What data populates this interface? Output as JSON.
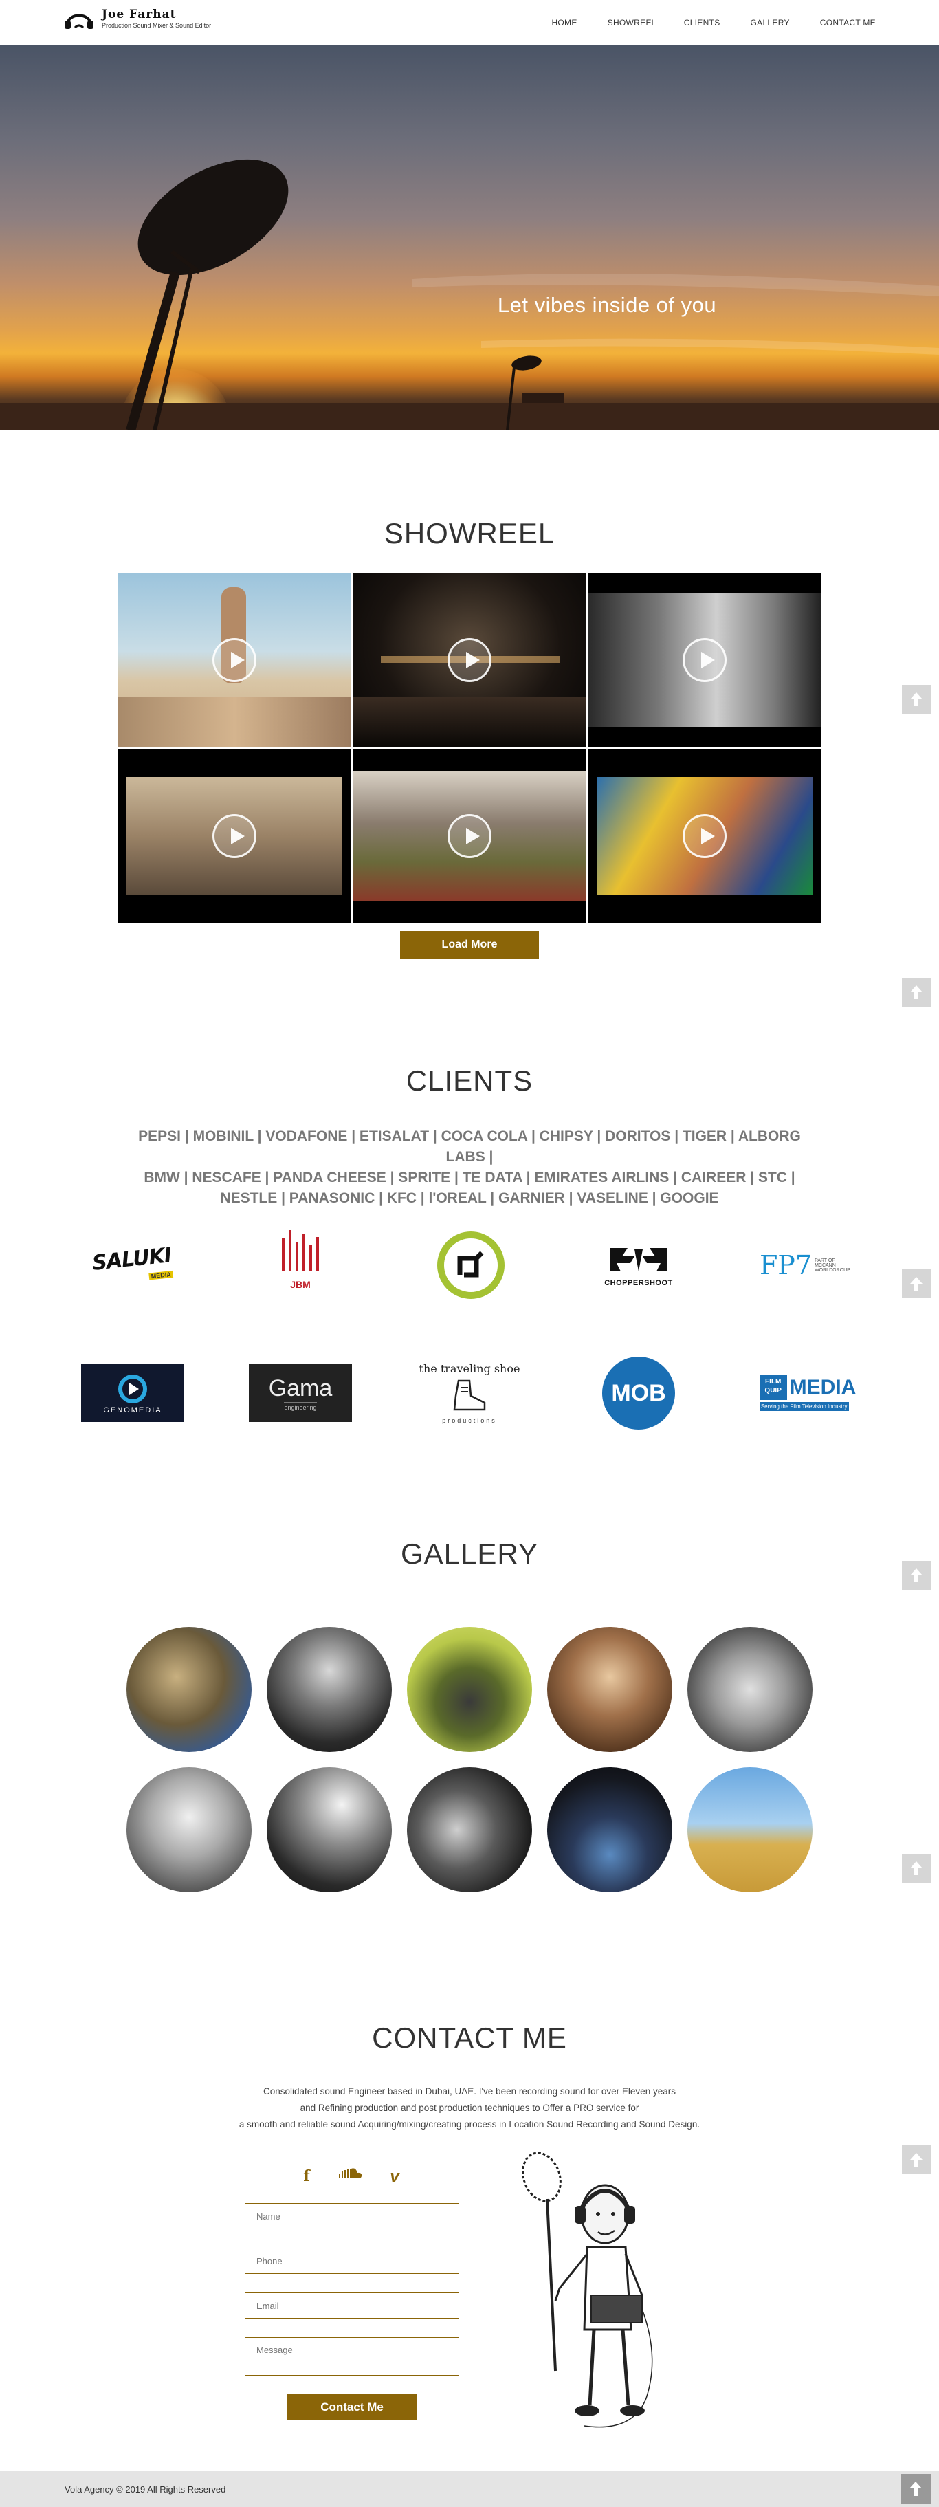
{
  "brand": {
    "name": "Joe Farhat",
    "subtitle": "Production Sound Mixer & Sound Editor"
  },
  "nav": {
    "items": [
      "HOME",
      "SHOWREEl",
      "CLIENTS",
      "GALLERY",
      "CONTACT ME"
    ]
  },
  "hero": {
    "tagline": "Let vibes inside of you"
  },
  "showreel": {
    "title": "SHOWREEL",
    "load_more": "Load More"
  },
  "clients": {
    "title": "CLIENTS",
    "line1": "PEPSI | MOBINIL | VODAFONE | ETISALAT | COCA COLA | CHIPSY | DORITOS | TIGER | ALBORG LABS |",
    "line2": "BMW | NESCAFE | PANDA CHEESE | SPRITE | TE DATA | EMIRATES AIRLINS | CAIREER | STC |",
    "line3": "NESTLE | PANASONIC | KFC | l'OREAL | GARNIER | VASELINE | GOOGIE",
    "logos": {
      "saluki": "SALUKI",
      "saluki_sub": "MEDIA",
      "jbm": "JBM",
      "choppershoot": "CHOPPERSHOOT",
      "fp7": "FP7",
      "fp7_sub": "PART OF MCCANN WORLDGROUP",
      "genomedia": "GENOMEDIA",
      "gama": "Gama",
      "gama_sub": "engineering",
      "traveling_shoe": "the traveling shoe",
      "traveling_shoe_sub": "productions",
      "mob": "MOB",
      "filmquip": "FILM QUIP",
      "filmquip_media": "MEDIA",
      "filmquip_sub": "Serving the Film Television Industry"
    }
  },
  "gallery": {
    "title": "GALLERY"
  },
  "contact": {
    "title": "CONTACT ME",
    "desc1": "Consolidated sound Engineer based in Dubai, UAE. I've been recording sound for over Eleven years",
    "desc2": "and Refining production and post production techniques to Offer a PRO service for",
    "desc3": "a smooth and reliable sound Acquiring/mixing/creating process in Location Sound Recording and Sound Design.",
    "social": {
      "facebook": "f",
      "vimeo": "v"
    },
    "placeholders": {
      "name": "Name",
      "phone": "Phone",
      "email": "Email",
      "message": "Message"
    },
    "button": "Contact Me"
  },
  "footer": {
    "text": "Vola Agency © 2019 All Rights Reserved"
  },
  "colors": {
    "accent": "#8b6508",
    "footer_bg": "#e4e4e4"
  }
}
